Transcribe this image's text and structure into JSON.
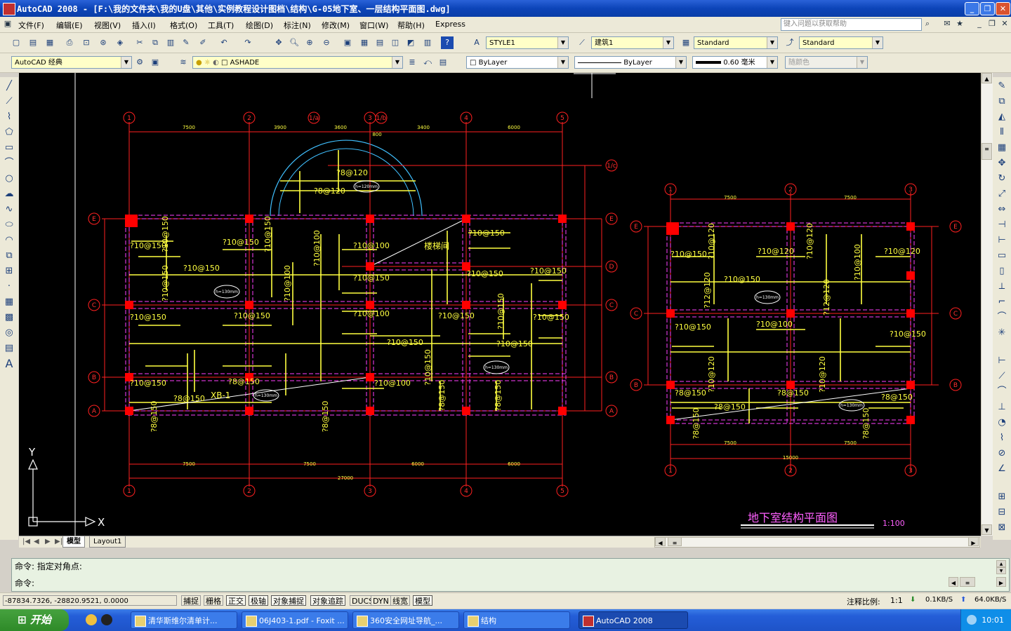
{
  "window": {
    "title": "AutoCAD 2008 - [F:\\我的文件夹\\我的U盘\\其他\\实例教程设计图档\\结构\\G-05地下室、一层结构平面图.dwg]"
  },
  "menu": {
    "items": [
      "文件(F)",
      "编辑(E)",
      "视图(V)",
      "插入(I)",
      "格式(O)",
      "工具(T)",
      "绘图(D)",
      "标注(N)",
      "修改(M)",
      "窗口(W)",
      "帮助(H)",
      "Express"
    ],
    "help_placeholder": "键入问题以获取帮助"
  },
  "toolbar1": {
    "text_style": "STYLE1",
    "dim_style": "建筑1",
    "table_style": "Standard",
    "multileader_style": "Standard"
  },
  "toolbar2": {
    "workspace": "AutoCAD 经典",
    "layer": "ASHADE",
    "color": "ByLayer",
    "linetype": "ByLayer",
    "lineweight": "0.60 毫米",
    "plot_style": "随颜色"
  },
  "drawing": {
    "main_title": "地下室结构平面图",
    "scale": "1:100",
    "main_grid_cols": [
      "1",
      "2",
      "3",
      "4",
      "5"
    ],
    "main_grid_rows": [
      "E",
      "D",
      "C",
      "B",
      "A"
    ],
    "extra_axis_labels": [
      "1/a",
      "1/b",
      "1/c"
    ],
    "main_top_dims": [
      "7500",
      "3900",
      "3600",
      "800",
      "3400",
      "6000"
    ],
    "main_bottom_dims": [
      "7500",
      "7500",
      "6000",
      "6000"
    ],
    "main_total": "27000",
    "right_grid_cols": [
      "1",
      "2",
      "3"
    ],
    "right_grid_rows": [
      "E",
      "C",
      "B"
    ],
    "right_dims": [
      "7500",
      "7500"
    ],
    "right_total": "15000",
    "rebar_labels_main": [
      "?10@150",
      "?10@150",
      "?10@150",
      "?10@150",
      "?10@150",
      "?10@100",
      "?10@150",
      "?10@150",
      "?8@150",
      "?8@120",
      "?8@120",
      "?10@150",
      "?10@100",
      "?10@150",
      "?10@150",
      "?10@150",
      "?8@150",
      "?10@150",
      "?10@100"
    ],
    "rebar_labels_right": [
      "?10@150",
      "?10@120",
      "?10@120",
      "?10@120",
      "?10@150",
      "?12@120",
      "?10@100",
      "?10@150",
      "?12@120",
      "?10@150",
      "?8@150",
      "?8@150",
      "?8@150",
      "?8@150"
    ],
    "room_label": "楼梯间",
    "slab_thickness": "h=130mm",
    "slab_thickness_alt": "h=120mm",
    "slab_mark": "XB-1",
    "ucs_x": "X",
    "ucs_y": "Y"
  },
  "tabs": [
    "模型",
    "Layout1"
  ],
  "command": {
    "line1": "命令: 指定对角点:",
    "line2": "命令:"
  },
  "status": {
    "coords": "-87834.7326, -28820.9521, 0.0000",
    "toggles": [
      "捕捉",
      "栅格",
      "正交",
      "极轴",
      "对象捕捉",
      "对象追踪",
      "DUCS",
      "DYN",
      "线宽",
      "模型"
    ],
    "annotation_scale_label": "注释比例:",
    "annotation_scale": "1:1",
    "download": "0.1KB/S",
    "upload": "64.0KB/S"
  },
  "taskbar": {
    "start": "开始",
    "tasks": [
      "清华斯维尔清单计...",
      "06J403-1.pdf - Foxit ...",
      "360安全网址导航_...",
      "结构",
      "AutoCAD 2008"
    ],
    "clock": "10:01"
  },
  "colors": {
    "grid": "#ff2020",
    "rebar": "#ffff40",
    "dashed": "#ff40ff",
    "title": "#ff60ff",
    "column": "#ff0000"
  }
}
